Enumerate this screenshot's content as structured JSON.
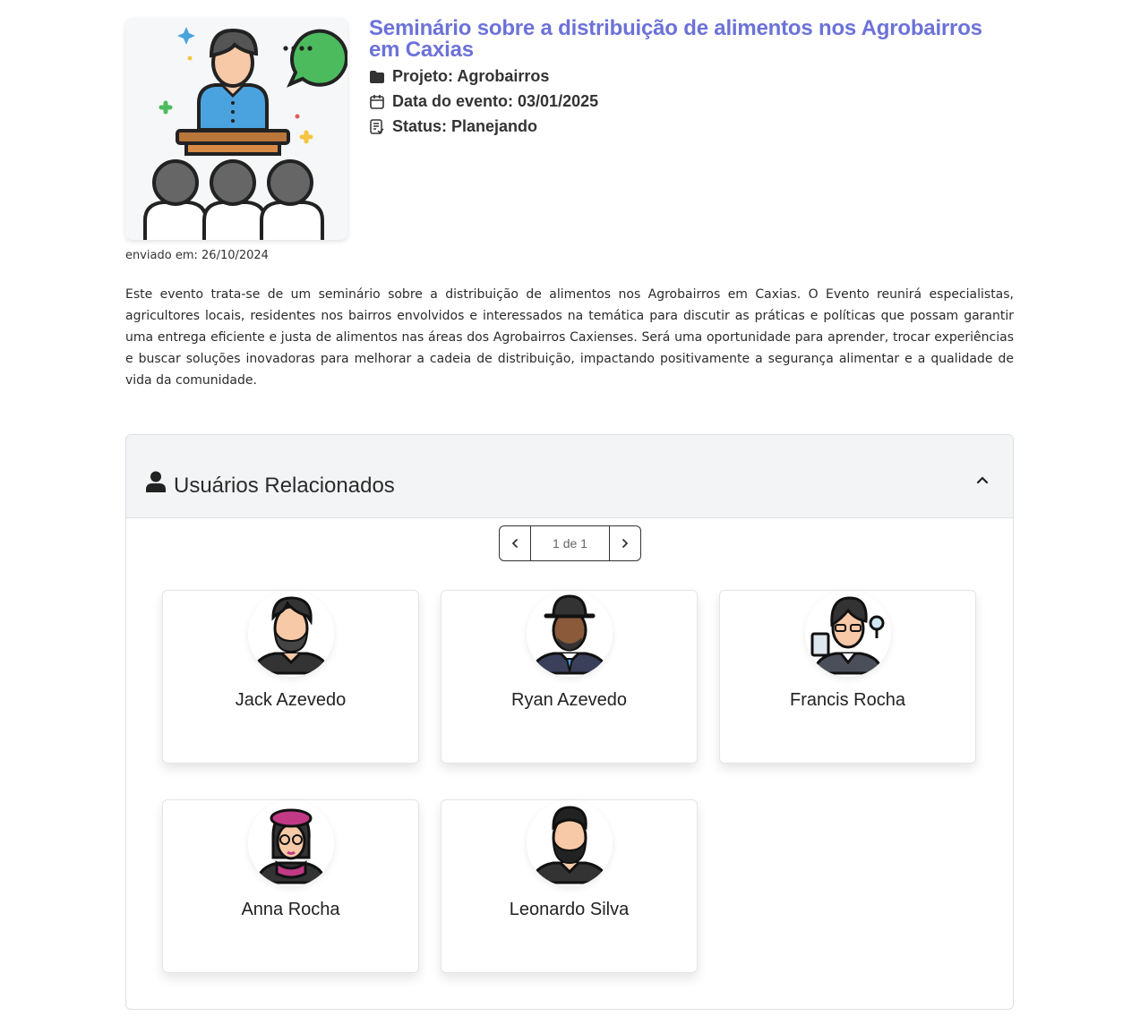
{
  "event": {
    "title": "Seminário sobre a distribuição de alimentos nos Agrobairros em Caxias",
    "project": "Projeto: Agrobairros",
    "date": "Data do evento: 03/01/2025",
    "status": "Status: Planejando",
    "sent": "enviado em: 26/10/2024",
    "image_icon": "seminar-illustration",
    "description": "Este evento trata-se de um seminário sobre a distribuição de alimentos nos Agrobairros em Caxias. O Evento reunirá especialistas, agricultores locais, residentes nos bairros envolvidos e interessados na temática para discutir as práticas e políticas que possam garantir uma entrega eficiente e justa de alimentos nas áreas dos Agrobairros Caxienses. Será uma oportunidade para aprender, trocar experiências e buscar soluções inovadoras para melhorar a cadeia de distribuição, impactando positivamente a segurança alimentar e a qualidade de vida da comunidade."
  },
  "related_users": {
    "title": "Usuários Relacionados",
    "pagination": "1 de 1",
    "users": [
      {
        "name": "Jack Azevedo",
        "avatar": "bearded-man-avatar"
      },
      {
        "name": "Ryan Azevedo",
        "avatar": "man-with-hat-avatar"
      },
      {
        "name": "Francis Rocha",
        "avatar": "inspector-avatar"
      },
      {
        "name": "Anna Rocha",
        "avatar": "woman-beret-avatar"
      },
      {
        "name": "Leonardo Silva",
        "avatar": "bearded-man-avatar"
      }
    ]
  },
  "colors": {
    "title": "#6c72d8",
    "panel_header_bg": "#f3f4f5"
  }
}
